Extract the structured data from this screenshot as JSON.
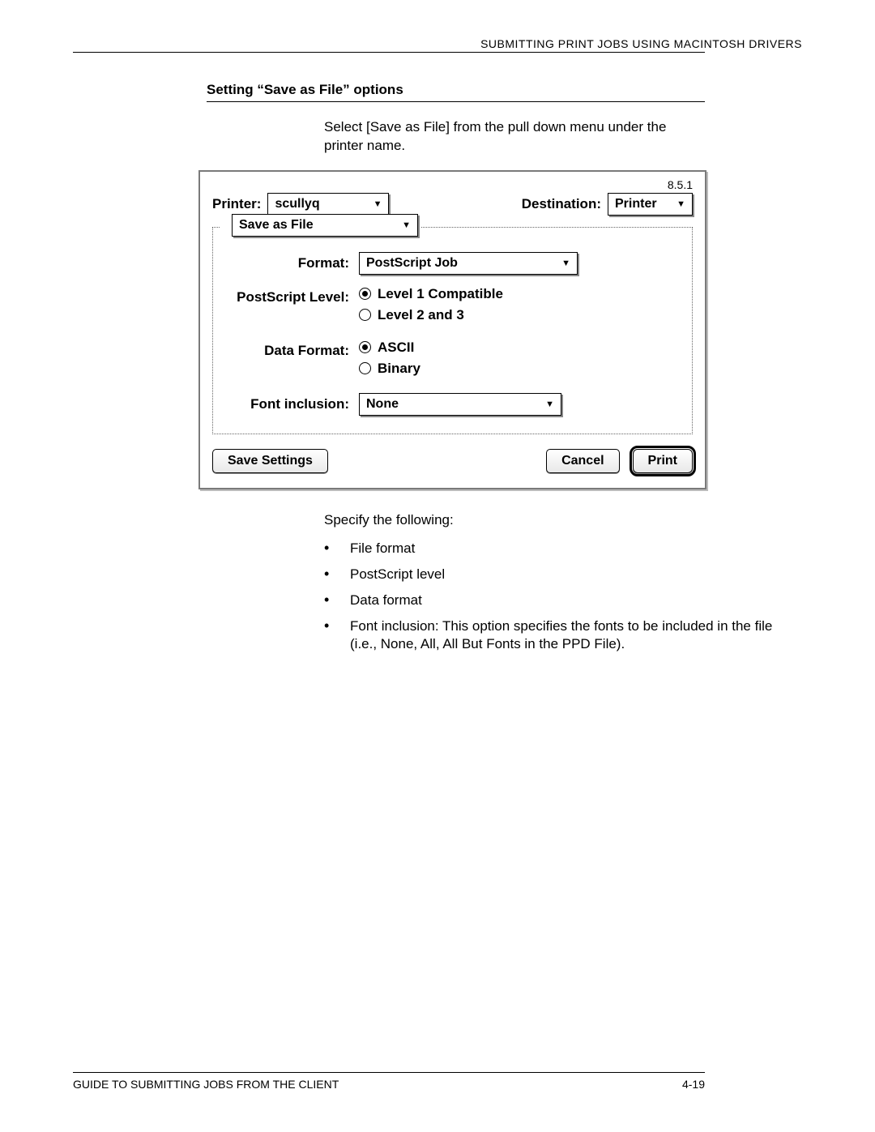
{
  "header": "SUBMITTING PRINT JOBS USING MACINTOSH DRIVERS",
  "section_heading": "Setting “Save as File” options",
  "intro": "Select [Save as File] from the pull down menu under the printer name.",
  "dialog": {
    "version": "8.5.1",
    "printer_label": "Printer:",
    "printer_value": "scullyq",
    "destination_label": "Destination:",
    "destination_value": "Printer",
    "panel_value": "Save as File",
    "format_label": "Format:",
    "format_value": "PostScript Job",
    "ps_level_label": "PostScript Level:",
    "ps_level_opt1": "Level 1 Compatible",
    "ps_level_opt2": "Level 2 and 3",
    "data_format_label": "Data Format:",
    "data_format_opt1": "ASCII",
    "data_format_opt2": "Binary",
    "font_label": "Font inclusion:",
    "font_value": "None",
    "save_settings": "Save Settings",
    "cancel": "Cancel",
    "print": "Print"
  },
  "after_text": "Specify the following:",
  "bullets": [
    "File format",
    "PostScript level",
    "Data format",
    "Font inclusion: This option specifies the fonts to be included in the file (i.e., None, All, All But Fonts in the PPD File)."
  ],
  "footer_left": "GUIDE TO SUBMITTING JOBS FROM THE CLIENT",
  "footer_right": "4-19"
}
